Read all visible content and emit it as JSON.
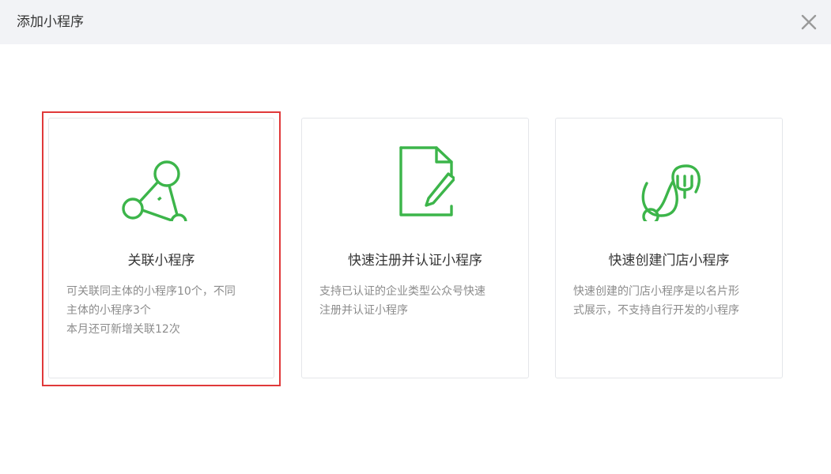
{
  "dialog": {
    "title": "添加小程序",
    "close_icon": "close-icon"
  },
  "colors": {
    "accent_green": "#3cb54a",
    "highlight_red": "#e0393a",
    "header_bg": "#f2f3f6",
    "desc_text": "#8c8c8c"
  },
  "cards": [
    {
      "icon": "link-network-icon",
      "title": "关联小程序",
      "desc_lines": [
        "可关联同主体的小程序10个，不同",
        "主体的小程序3个",
        "本月还可新增关联12次"
      ]
    },
    {
      "icon": "document-edit-icon",
      "title": "快速注册并认证小程序",
      "desc_lines": [
        "支持已认证的企业类型公众号快速",
        "注册并认证小程序"
      ]
    },
    {
      "icon": "store-fork-icon",
      "title": "快速创建门店小程序",
      "desc_lines": [
        "快速创建的门店小程序是以名片形",
        "式展示，不支持自行开发的小程序"
      ]
    }
  ]
}
